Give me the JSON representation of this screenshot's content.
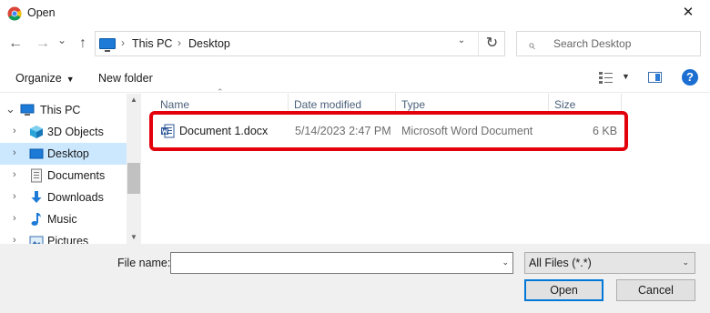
{
  "window": {
    "title": "Open",
    "close_glyph": "✕"
  },
  "nav": {
    "back_glyph": "←",
    "forward_glyph": "→",
    "recent_glyph": "⌄",
    "up_glyph": "↑"
  },
  "address": {
    "icon": "monitor-icon",
    "separator": "›",
    "segments": [
      "This PC",
      "Desktop"
    ],
    "dropdown_glyph": "⌄",
    "refresh_glyph": "↻"
  },
  "search": {
    "placeholder": "Search Desktop",
    "icon_glyph": "⌕"
  },
  "toolbar": {
    "organize_label": "Organize",
    "caret": "▼",
    "new_folder_label": "New folder",
    "help_glyph": "?"
  },
  "sidebar": {
    "items": [
      {
        "label": "This PC",
        "icon": "this-pc-icon",
        "chevron": "⌄"
      },
      {
        "label": "3D Objects",
        "icon": "3d-objects-icon",
        "chevron": "›"
      },
      {
        "label": "Desktop",
        "icon": "desktop-icon",
        "chevron": "›"
      },
      {
        "label": "Documents",
        "icon": "documents-icon",
        "chevron": "›"
      },
      {
        "label": "Downloads",
        "icon": "downloads-icon",
        "chevron": "›"
      },
      {
        "label": "Music",
        "icon": "music-icon",
        "chevron": "›"
      },
      {
        "label": "Pictures",
        "icon": "pictures-icon",
        "chevron": "›"
      }
    ],
    "scroll_up_glyph": "▲",
    "scroll_down_glyph": "▼"
  },
  "file_list": {
    "sort_glyph": "⌃",
    "columns": [
      "Name",
      "Date modified",
      "Type",
      "Size"
    ],
    "rows": [
      {
        "name": "Document 1.docx",
        "date_modified": "5/14/2023 2:47 PM",
        "type": "Microsoft Word Document",
        "size": "6 KB",
        "icon": "word-doc-icon"
      }
    ]
  },
  "footer": {
    "file_name_label": "File name:",
    "file_name_value": "",
    "file_type_value": "All Files (*.*)",
    "caret": "⌄",
    "open_label": "Open",
    "cancel_label": "Cancel"
  },
  "colors": {
    "highlight": "#e3000b",
    "selection": "#cce8ff",
    "accent": "#0078d7"
  }
}
